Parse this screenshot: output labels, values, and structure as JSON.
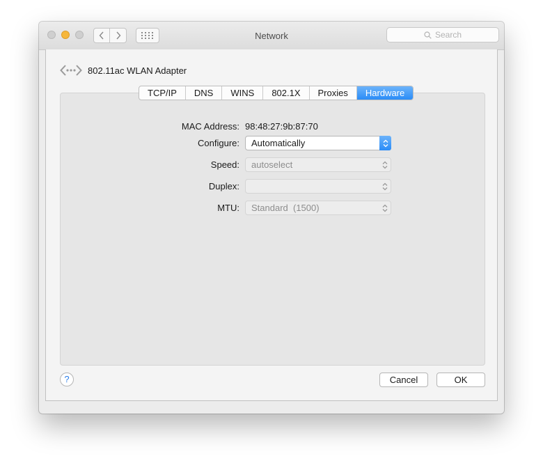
{
  "window": {
    "title": "Network",
    "search_placeholder": "Search"
  },
  "adapter": {
    "name": "802.11ac WLAN Adapter",
    "icon": "network-adapter-icon"
  },
  "tabs": [
    {
      "label": "TCP/IP",
      "active": false
    },
    {
      "label": "DNS",
      "active": false
    },
    {
      "label": "WINS",
      "active": false
    },
    {
      "label": "802.1X",
      "active": false
    },
    {
      "label": "Proxies",
      "active": false
    },
    {
      "label": "Hardware",
      "active": true
    }
  ],
  "hardware": {
    "mac_label": "MAC Address:",
    "mac_value": "98:48:27:9b:87:70",
    "configure_label": "Configure:",
    "configure_value": "Automatically",
    "speed_label": "Speed:",
    "speed_value": "autoselect",
    "duplex_label": "Duplex:",
    "duplex_value": "",
    "mtu_label": "MTU:",
    "mtu_value": "Standard  (1500)"
  },
  "footer": {
    "help": "?",
    "cancel": "Cancel",
    "ok": "OK"
  },
  "colors": {
    "accent": "#2a8cf7",
    "minimize": "#f6b73c"
  }
}
